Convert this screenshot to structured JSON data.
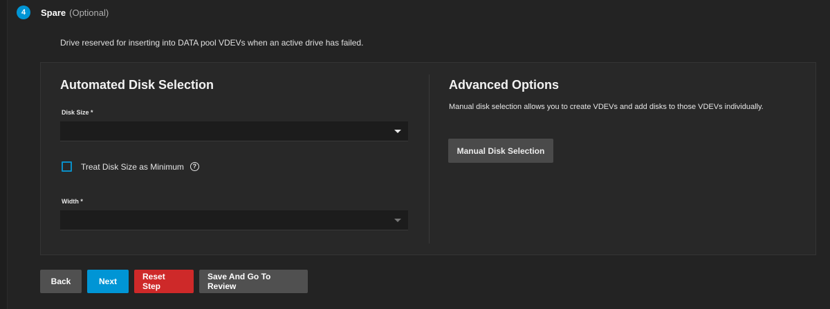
{
  "step": {
    "number": "4",
    "title": "Spare",
    "optional": "(Optional)",
    "description": "Drive reserved for inserting into DATA pool VDEVs when an active drive has failed."
  },
  "automated": {
    "title": "Automated Disk Selection",
    "disk_size_label": "Disk Size *",
    "disk_size_value": "",
    "treat_min_label": "Treat Disk Size as Minimum",
    "treat_min_checked": false,
    "width_label": "Width *",
    "width_value": ""
  },
  "advanced": {
    "title": "Advanced Options",
    "description": "Manual disk selection allows you to create VDEVs and add disks to those VDEVs individually.",
    "manual_button": "Manual Disk Selection"
  },
  "actions": {
    "back": "Back",
    "next": "Next",
    "reset": "Reset Step",
    "review": "Save And Go To Review"
  },
  "colors": {
    "accent": "#0095d5",
    "danger": "#ce2929",
    "background": "#232323"
  }
}
